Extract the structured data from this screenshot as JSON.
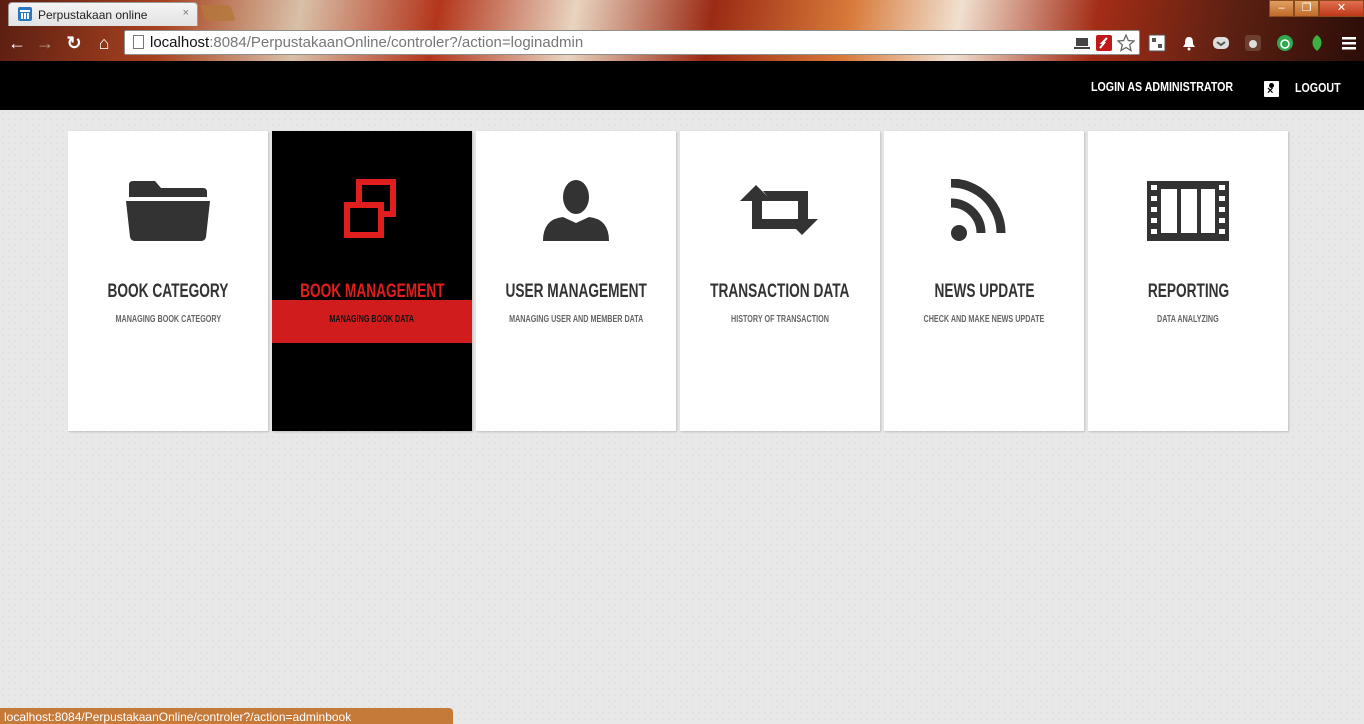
{
  "browser": {
    "tab_title": "Perpustakaan online",
    "tab_close": "×",
    "url_host": "localhost",
    "url_path": ":8084/PerpustakaanOnline/controler?/action=loginadmin",
    "status_url": "localhost:8084/PerpustakaanOnline/controler?/action=adminbook",
    "window_buttons": [
      "–",
      "❐",
      "✕"
    ]
  },
  "header": {
    "login_label": "LOGIN AS ADMINISTRATOR",
    "logout_label": "LOGOUT"
  },
  "tiles": [
    {
      "title": "BOOK CATEGORY",
      "subtitle": "MANAGING BOOK CATEGORY",
      "icon": "folder-icon"
    },
    {
      "title": "BOOK MANAGEMENT",
      "subtitle": "MANAGING BOOK DATA",
      "icon": "windows-icon",
      "active": true
    },
    {
      "title": "USER MANAGEMENT",
      "subtitle": "MANAGING USER AND MEMBER DATA",
      "icon": "user-icon"
    },
    {
      "title": "TRANSACTION DATA",
      "subtitle": "HISTORY OF TRANSACTION",
      "icon": "retweet-icon"
    },
    {
      "title": "NEWS UPDATE",
      "subtitle": "CHECK AND MAKE NEWS UPDATE",
      "icon": "rss-icon"
    },
    {
      "title": "REPORTING",
      "subtitle": "DATA ANALYZING",
      "icon": "film-icon"
    }
  ],
  "colors": {
    "accent": "#d01c1c",
    "header_bg": "#000000",
    "icon_gray": "#333333"
  }
}
